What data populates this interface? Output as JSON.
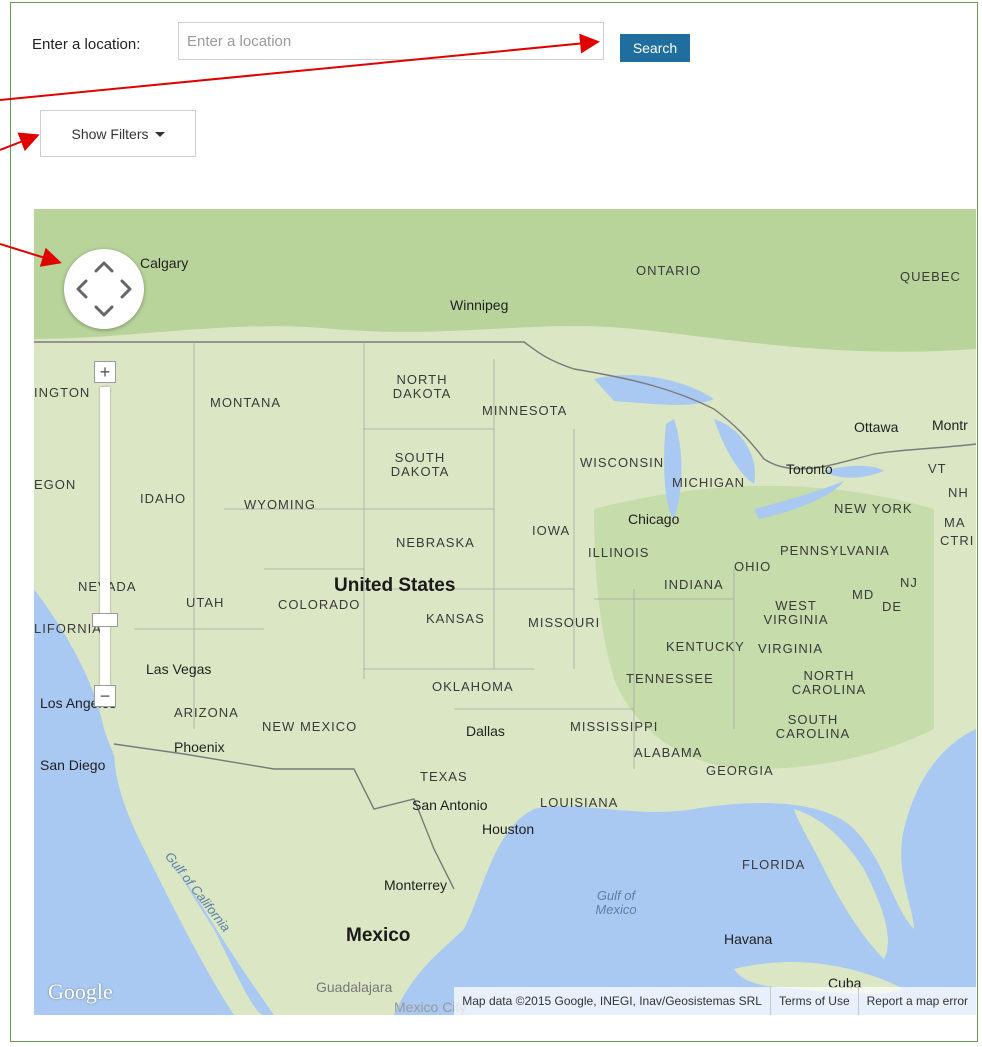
{
  "search": {
    "label": "Enter a location:",
    "placeholder": "Enter a location",
    "value": "",
    "button_label": "Search"
  },
  "filters": {
    "button_label": "Show Filters"
  },
  "map": {
    "labels": {
      "calgary": "Calgary",
      "winnipeg": "Winnipeg",
      "ontario": "ONTARIO",
      "quebec": "QUEBEC",
      "washington": "INGTON",
      "montana": "MONTANA",
      "north_dakota": "NORTH DAKOTA",
      "minnesota": "MINNESOTA",
      "ottawa": "Ottawa",
      "montreal": "Montr",
      "south_dakota": "SOUTH DAKOTA",
      "wisconsin": "WISCONSIN",
      "michigan": "MICHIGAN",
      "toronto": "Toronto",
      "vt": "VT",
      "nh": "NH",
      "oregon": "EGON",
      "idaho": "IDAHO",
      "wyoming": "WYOMING",
      "iowa": "IOWA",
      "chicago": "Chicago",
      "new_york": "NEW YORK",
      "ma": "MA",
      "ctri": "CTRI",
      "nebraska": "NEBRASKA",
      "illinois": "ILLINOIS",
      "ohio": "OHIO",
      "pennsylvania": "PENNSYLVANIA",
      "nevada": "NEVADA",
      "utah": "UTAH",
      "united_states": "United States",
      "colorado": "COLORADO",
      "indiana": "INDIANA",
      "nj": "NJ",
      "md": "MD",
      "de": "DE",
      "kansas": "KANSAS",
      "missouri": "MISSOURI",
      "west_virginia": "WEST VIRGINIA",
      "california": "LIFORNIA",
      "kentucky": "KENTUCKY",
      "virginia": "VIRGINIA",
      "las_vegas": "Las Vegas",
      "oklahoma": "OKLAHOMA",
      "tennessee": "TENNESSEE",
      "north_carolina": "NORTH CAROLINA",
      "los_angeles": "Los Angeles",
      "arizona": "ARIZONA",
      "new_mexico": "NEW MEXICO",
      "dallas": "Dallas",
      "mississippi": "MISSISSIPPI",
      "south_carolina": "SOUTH CAROLINA",
      "phoenix": "Phoenix",
      "alabama": "ALABAMA",
      "san_diego": "San Diego",
      "georgia": "GEORGIA",
      "texas": "TEXAS",
      "san_antonio": "San Antonio",
      "louisiana": "LOUISIANA",
      "houston": "Houston",
      "gulf_california": "Gulf of California",
      "florida": "FLORIDA",
      "monterrey": "Monterrey",
      "gulf_mexico": "Gulf of Mexico",
      "mexico": "Mexico",
      "havana": "Havana",
      "guadalajara": "Guadalajara",
      "cuba": "Cuba",
      "mexico_city": "Mexico City"
    },
    "google_logo": "Google",
    "attribution": "Map data ©2015 Google, INEGI, Inav/Geosistemas SRL",
    "terms_label": "Terms of Use",
    "report_label": "Report a map error",
    "colors": {
      "water": "#a9c9f2",
      "land": "#dbe7c4",
      "forest": "#b9d49b",
      "border": "#777777"
    }
  }
}
